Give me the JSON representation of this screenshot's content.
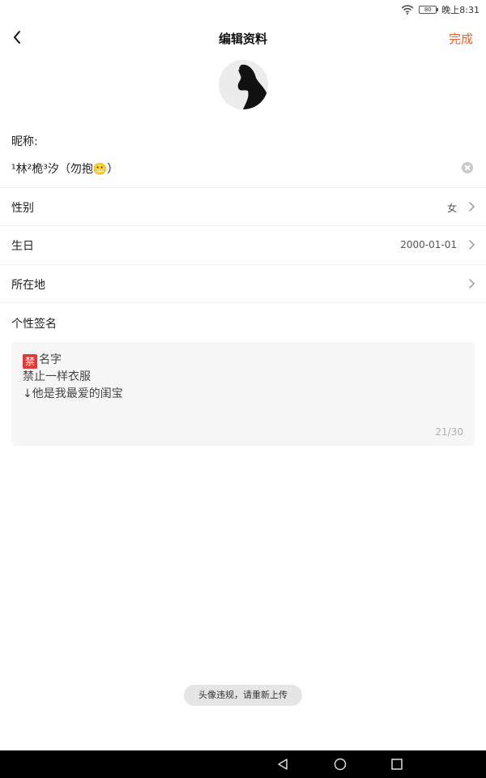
{
  "status_bar": {
    "time": "晚上8:31",
    "battery_level": "80",
    "icons": [
      "wifi-icon",
      "battery-icon"
    ]
  },
  "header": {
    "back_icon": "chevron-left-icon",
    "title": "编辑资料",
    "done_label": "完成",
    "done_color": "#ff5a1f"
  },
  "profile": {
    "avatar": "avatar"
  },
  "nickname": {
    "label": "昵称:",
    "value": "¹林²桅³汐（勿抱😬）",
    "clear_icon": "clear-icon"
  },
  "fields": [
    {
      "label": "性别",
      "value": "女"
    },
    {
      "label": "生日",
      "value": "2000-01-01"
    },
    {
      "label": "所在地",
      "value": ""
    }
  ],
  "signature": {
    "label": "个性签名",
    "badge": "禁",
    "badge_color": "#e53935",
    "text": "名字\n禁止一样衣服\n↓他是我最爱的闺宝",
    "counter": "21/30"
  },
  "toast": {
    "message": "头像违规，请重新上传"
  },
  "nav_bar": {
    "icons": [
      "back-triangle-icon",
      "home-circle-icon",
      "recents-square-icon"
    ]
  }
}
